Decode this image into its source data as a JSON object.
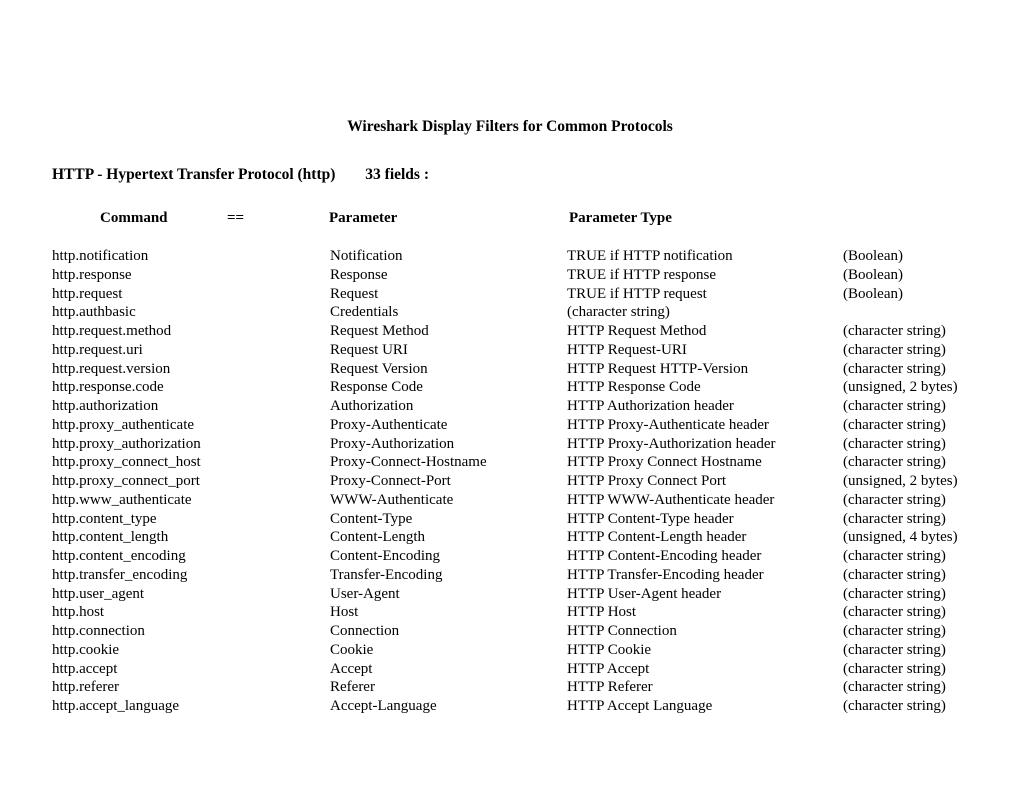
{
  "title": "Wireshark Display Filters for Common Protocols",
  "section": {
    "protocol_label": "HTTP - Hypertext Transfer Protocol (http)",
    "fields_label": "33 fields :"
  },
  "headers": {
    "command": "Command",
    "eq": "==",
    "parameter": "Parameter",
    "parameter_type": "Parameter Type"
  },
  "rows": [
    {
      "command": "http.notification",
      "parameter": "Notification",
      "desc": "TRUE if HTTP notification",
      "type": "(Boolean)"
    },
    {
      "command": "http.response",
      "parameter": "Response",
      "desc": "TRUE if HTTP response",
      "type": "(Boolean)"
    },
    {
      "command": "http.request",
      "parameter": "Request",
      "desc": "TRUE if HTTP request",
      "type": "(Boolean)"
    },
    {
      "command": "http.authbasic",
      "parameter": "Credentials",
      "desc": "(character string)",
      "type": ""
    },
    {
      "command": "http.request.method",
      "parameter": "Request Method",
      "desc": "HTTP Request Method",
      "type": "(character string)"
    },
    {
      "command": "http.request.uri",
      "parameter": "Request URI",
      "desc": "HTTP Request-URI",
      "type": "(character string)"
    },
    {
      "command": "http.request.version",
      "parameter": "Request Version",
      "desc": "HTTP Request HTTP-Version",
      "type": "(character string)"
    },
    {
      "command": "http.response.code",
      "parameter": "Response Code",
      "desc": "HTTP Response Code",
      "type": "(unsigned, 2 bytes)"
    },
    {
      "command": "http.authorization",
      "parameter": "Authorization",
      "desc": "HTTP Authorization header",
      "type": "(character string)"
    },
    {
      "command": "http.proxy_authenticate",
      "parameter": "Proxy-Authenticate",
      "desc": "HTTP Proxy-Authenticate header",
      "type": "(character string)"
    },
    {
      "command": "http.proxy_authorization",
      "parameter": "Proxy-Authorization",
      "desc": "HTTP Proxy-Authorization header",
      "type": "(character string)"
    },
    {
      "command": "http.proxy_connect_host",
      "parameter": "Proxy-Connect-Hostname",
      "desc": "HTTP Proxy Connect Hostname",
      "type": "(character string)"
    },
    {
      "command": "http.proxy_connect_port",
      "parameter": "Proxy-Connect-Port",
      "desc": "HTTP Proxy Connect Port",
      "type": "(unsigned, 2 bytes)"
    },
    {
      "command": "http.www_authenticate",
      "parameter": "WWW-Authenticate",
      "desc": "HTTP WWW-Authenticate header",
      "type": "(character string)"
    },
    {
      "command": "http.content_type",
      "parameter": "Content-Type",
      "desc": "HTTP Content-Type header",
      "type": "(character string)"
    },
    {
      "command": "http.content_length",
      "parameter": "Content-Length",
      "desc": "HTTP Content-Length header",
      "type": "(unsigned, 4 bytes)"
    },
    {
      "command": "http.content_encoding",
      "parameter": "Content-Encoding",
      "desc": "HTTP Content-Encoding header",
      "type": "(character string)"
    },
    {
      "command": "http.transfer_encoding",
      "parameter": "Transfer-Encoding",
      "desc": "HTTP Transfer-Encoding header",
      "type": "(character string)"
    },
    {
      "command": "http.user_agent",
      "parameter": "User-Agent",
      "desc": "HTTP User-Agent header",
      "type": "(character string)"
    },
    {
      "command": "http.host",
      "parameter": "Host",
      "desc": "HTTP Host",
      "type": "(character string)"
    },
    {
      "command": "http.connection",
      "parameter": "Connection",
      "desc": "HTTP Connection",
      "type": "(character string)"
    },
    {
      "command": "http.cookie",
      "parameter": "Cookie",
      "desc": "HTTP Cookie",
      "type": "(character string)"
    },
    {
      "command": "http.accept",
      "parameter": "Accept",
      "desc": "HTTP Accept",
      "type": "(character string)"
    },
    {
      "command": "http.referer",
      "parameter": "Referer",
      "desc": "HTTP Referer",
      "type": "(character string)"
    },
    {
      "command": "http.accept_language",
      "parameter": "Accept-Language",
      "desc": "HTTP Accept Language",
      "type": "(character string)"
    }
  ]
}
